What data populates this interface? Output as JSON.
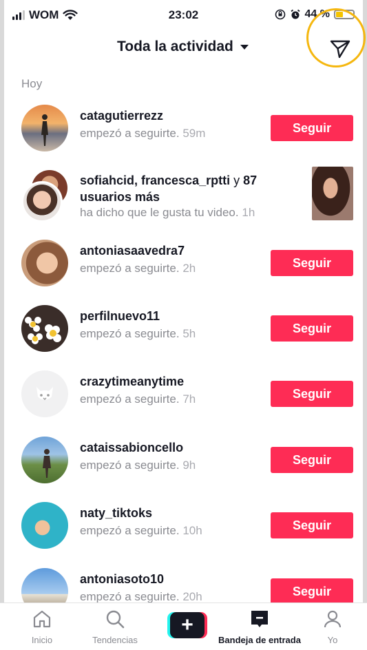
{
  "status": {
    "carrier": "WOM",
    "time": "23:02",
    "battery": "44 %"
  },
  "header": {
    "title": "Toda la actividad"
  },
  "section": {
    "label": "Hoy"
  },
  "rows": [
    {
      "user": "catagutierrezz",
      "action": "empezó a seguirte.",
      "time": "59m",
      "button": "Seguir"
    },
    {
      "user": "sofiahcid, francesca_rptti",
      "user_mid": " y ",
      "user_bold2": "87",
      "user_line2": "usuarios más",
      "action": "ha dicho que le gusta tu video.",
      "time": "1h"
    },
    {
      "user": "antoniasaavedra7",
      "action": "empezó a seguirte.",
      "time": "2h",
      "button": "Seguir"
    },
    {
      "user": "perfilnuevo11",
      "action": "empezó a seguirte.",
      "time": "5h",
      "button": "Seguir"
    },
    {
      "user": "crazytimeanytime",
      "action": "empezó a seguirte.",
      "time": "7h",
      "button": "Seguir"
    },
    {
      "user": "cataissabioncello",
      "action": "empezó a seguirte.",
      "time": "9h",
      "button": "Seguir"
    },
    {
      "user": "naty_tiktoks",
      "action": "empezó a seguirte.",
      "time": "10h",
      "button": "Seguir"
    },
    {
      "user": "antoniasoto10",
      "action": "empezó a seguirte.",
      "time": "20h",
      "button": "Seguir"
    }
  ],
  "tabs": {
    "home": "Inicio",
    "discover": "Tendencias",
    "create": "+",
    "inbox": "Bandeja de entrada",
    "me": "Yo"
  },
  "colors": {
    "accent": "#fe2c55",
    "highlight_ring": "#f5b70f",
    "cyan": "#25f4ee"
  }
}
